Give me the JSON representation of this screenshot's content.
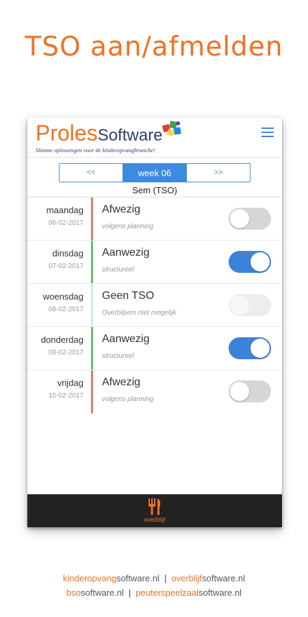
{
  "headline": "TSO aan/afmelden",
  "app": {
    "logo_primary": "Proles",
    "logo_secondary": "Software",
    "logo_tagline": "Slimme oplossingen voor de kinderopvangbranche!"
  },
  "week_nav": {
    "prev": "<<",
    "current": "week 06",
    "next": ">>"
  },
  "child_name": "Sem (TSO)",
  "days": [
    {
      "name": "maandag",
      "date": "06-02-2017",
      "status": "Afwezig",
      "sub": "volgens planning",
      "toggle": "off",
      "bar_color": "#e57373"
    },
    {
      "name": "dinsdag",
      "date": "07-02-2017",
      "status": "Aanwezig",
      "sub": "structureel",
      "toggle": "on",
      "bar_color": "#66bb6a"
    },
    {
      "name": "woensdag",
      "date": "08-02-2017",
      "status": "Geen TSO",
      "sub": "Overblijven niet mogelijk",
      "toggle": "disabled",
      "bar_color": "#cfe5f1"
    },
    {
      "name": "donderdag",
      "date": "09-02-2017",
      "status": "Aanwezig",
      "sub": "structureel",
      "toggle": "on",
      "bar_color": "#66bb6a"
    },
    {
      "name": "vrijdag",
      "date": "10-02-2017",
      "status": "Afwezig",
      "sub": "volgens planning",
      "toggle": "off",
      "bar_color": "#e57373"
    }
  ],
  "bottom_nav": {
    "label": "overblijf",
    "icon": "fork-knife-icon"
  },
  "footer": {
    "line1": [
      {
        "hl": "kinderopvang",
        "rest": "software.nl"
      },
      {
        "hl": "overblijf",
        "rest": "software.nl"
      }
    ],
    "line2": [
      {
        "hl": "bso",
        "rest": "software.nl"
      },
      {
        "hl": "peuterspeelzaal",
        "rest": "software.nl"
      }
    ],
    "separator": "|"
  },
  "colors": {
    "brand_orange": "#f07122",
    "brand_navy": "#2c3d73",
    "accent_blue": "#3d82d9"
  }
}
